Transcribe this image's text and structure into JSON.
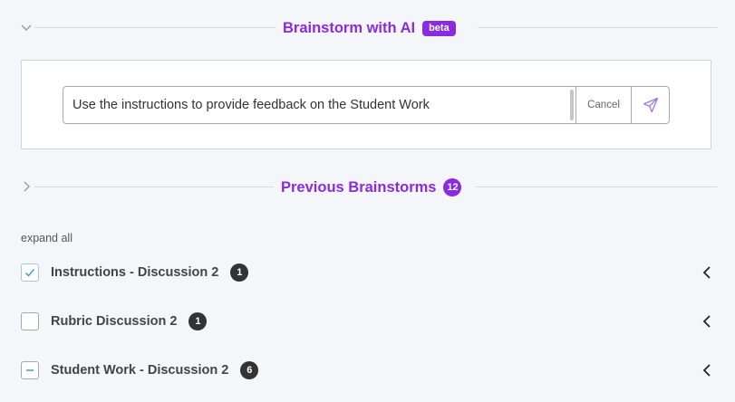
{
  "brainstorm": {
    "title": "Brainstorm with AI",
    "badge": "beta",
    "prompt_value": "Use the instructions to provide feedback on the Student Work",
    "cancel_label": "Cancel"
  },
  "previous": {
    "title": "Previous Brainstorms",
    "count": "12",
    "expand_all_label": "expand all",
    "items": [
      {
        "label": "Instructions - Discussion 2",
        "count": "1",
        "state": "checked"
      },
      {
        "label": "Rubric Discussion 2",
        "count": "1",
        "state": "unchecked"
      },
      {
        "label": "Student Work - Discussion 2",
        "count": "6",
        "state": "indeterminate"
      }
    ]
  },
  "colors": {
    "accent": "#8a2be2",
    "checkbox_check": "#4a9fd8",
    "badge_dark": "#333333",
    "send_icon": "#a37be0"
  },
  "icons": {
    "section_collapse": "chevron-down-icon",
    "section_expand": "chevron-right-icon",
    "send": "paper-plane-icon",
    "row_toggle": "chevron-left-icon"
  }
}
